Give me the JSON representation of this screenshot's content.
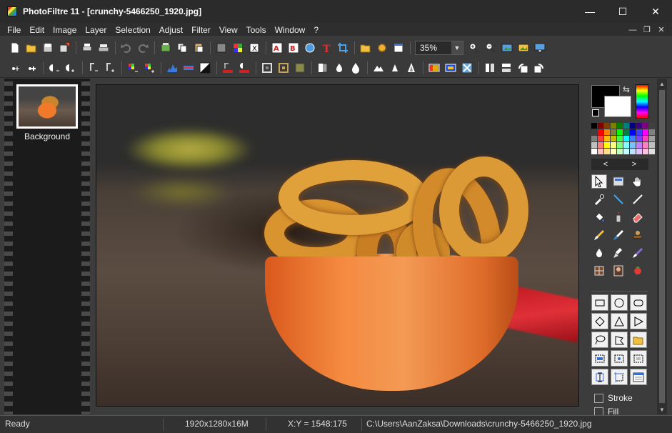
{
  "window": {
    "title": "PhotoFiltre 11 - [crunchy-5466250_1920.jpg]",
    "minimize": "—",
    "maximize": "☐",
    "close": "✕"
  },
  "menu": [
    "File",
    "Edit",
    "Image",
    "Layer",
    "Selection",
    "Adjust",
    "Filter",
    "View",
    "Tools",
    "Window",
    "?"
  ],
  "mdi": {
    "minimize": "—",
    "restore": "❐",
    "close": "✕"
  },
  "toolbar": {
    "zoom_value": "35%"
  },
  "layers": {
    "items": [
      {
        "label": "Background"
      }
    ]
  },
  "palette_colors": [
    "#000000",
    "#7f0000",
    "#7f3f00",
    "#7f7f00",
    "#007f00",
    "#007f7f",
    "#00007f",
    "#3f007f",
    "#7f007f",
    "#404040",
    "#3f3f3f",
    "#ff0000",
    "#ff7f00",
    "#7f7f3f",
    "#00ff00",
    "#007f3f",
    "#0000ff",
    "#3f3fff",
    "#ff00ff",
    "#808080",
    "#7f7f7f",
    "#ff3f3f",
    "#ffbf00",
    "#bfbf00",
    "#3fff3f",
    "#00ffff",
    "#3f7fff",
    "#7f3fff",
    "#ff3fbf",
    "#a0a0a0",
    "#bfbfbf",
    "#ff7f7f",
    "#ffff00",
    "#ffff7f",
    "#7fff7f",
    "#7fffff",
    "#7fbfff",
    "#bf7fff",
    "#ff7fbf",
    "#c0c0c0",
    "#ffffff",
    "#ffbfbf",
    "#ffdf7f",
    "#ffffbf",
    "#bfffbf",
    "#bfffff",
    "#bfdfff",
    "#dfbfff",
    "#ffbfdf",
    "#e0e0e0"
  ],
  "colors": {
    "foreground": "#000000",
    "background": "#ffffff"
  },
  "palette_nav": {
    "prev": "<",
    "next": ">"
  },
  "options": {
    "stroke_label": "Stroke",
    "fill_label": "Fill"
  },
  "status": {
    "state": "Ready",
    "image_info": "1920x1280x16M",
    "coords": "X:Y = 1548:175",
    "path": "C:\\Users\\AanZaksa\\Downloads\\crunchy-5466250_1920.jpg"
  }
}
